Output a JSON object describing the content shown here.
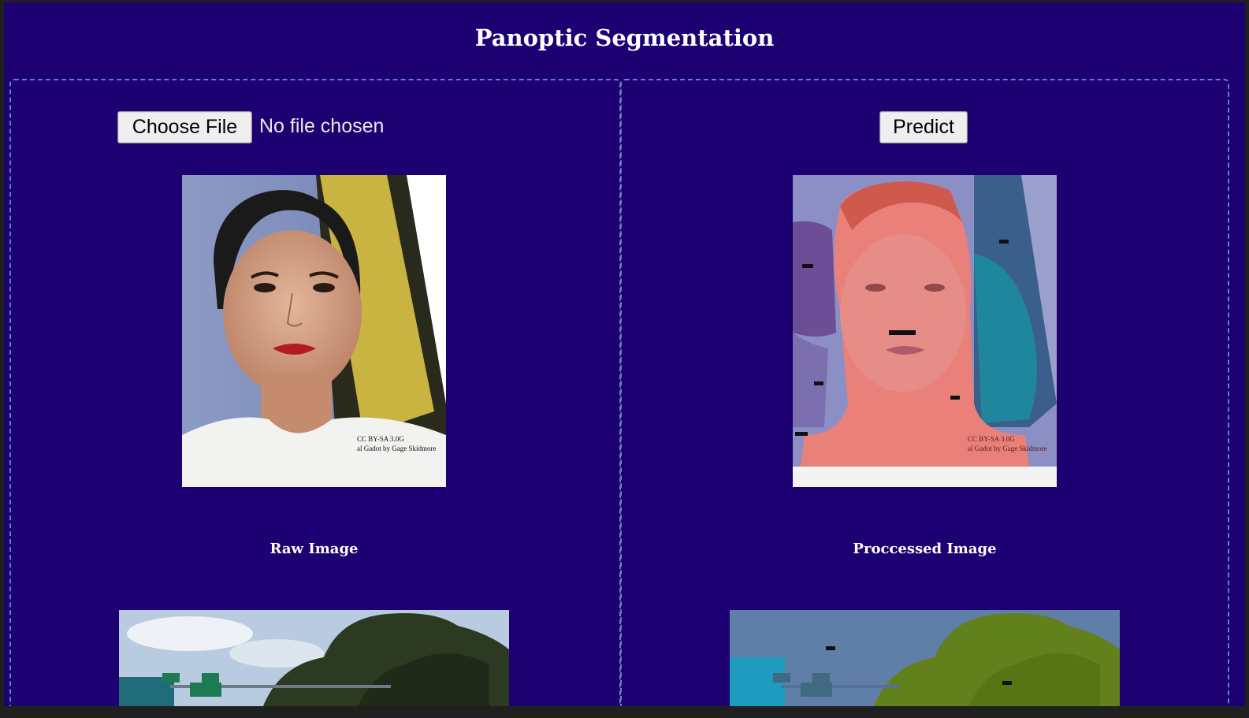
{
  "page": {
    "title": "Panoptic Segmentation"
  },
  "upload": {
    "choose_file_label": "Choose File",
    "file_status": "No file chosen"
  },
  "predict": {
    "label": "Predict"
  },
  "captions": {
    "raw": "Raw Image",
    "processed": "Proccessed Image"
  },
  "portrait_overlay": {
    "watermark_line1": "CC BY-SA 3.0G",
    "watermark_line2": "al Gadot by Gage Skidmore"
  },
  "colors": {
    "page_background": "#1d0072",
    "panel_border": "#6a79c8",
    "text": "#ffffff",
    "button_background": "#efefef"
  }
}
